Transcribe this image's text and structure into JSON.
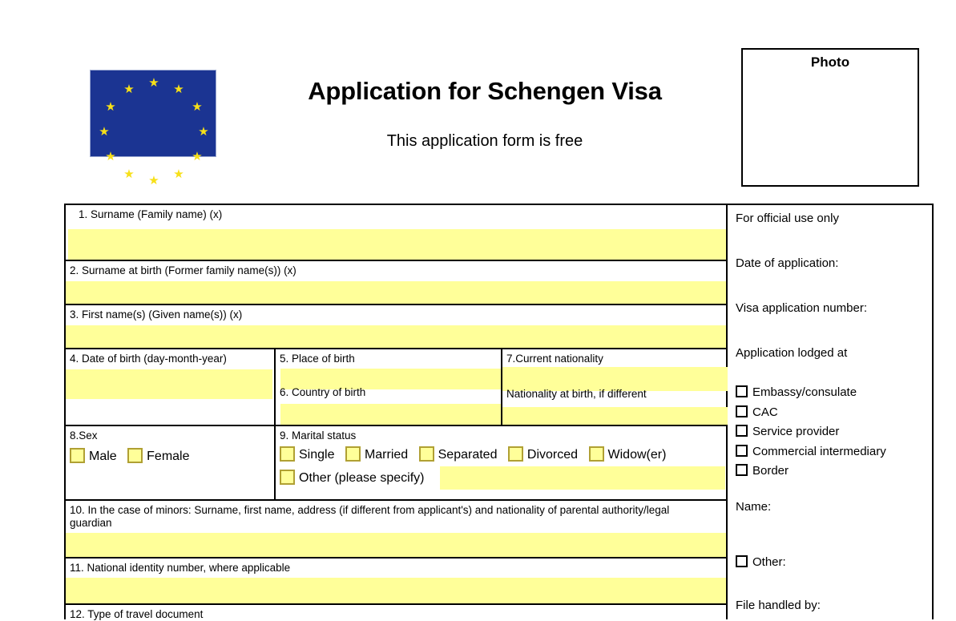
{
  "header": {
    "title": "Application for Schengen Visa",
    "subtitle": "This application form is free",
    "photo_label": "Photo",
    "flag_icon": "eu-flag-icon",
    "flag_color": "#1b3492",
    "star_color": "#f7e018"
  },
  "colors": {
    "field_yellow": "#ffff99",
    "checkbox_border_yellow": "#b0a033",
    "border_black": "#000000"
  },
  "form": {
    "field1": {
      "label": "1. Surname (Family name) (x)",
      "value": ""
    },
    "field2": {
      "label": "2. Surname at birth (Former family name(s)) (x)",
      "value": ""
    },
    "field3": {
      "label": "3. First name(s) (Given name(s)) (x)",
      "value": ""
    },
    "field4": {
      "label": "4. Date of birth (day-month-year)",
      "value": ""
    },
    "field5": {
      "label": "5. Place of birth",
      "value": ""
    },
    "field6": {
      "label": "6. Country of birth",
      "value": ""
    },
    "field7": {
      "label": "7.Current nationality",
      "value": "",
      "sublabel": "Nationality at birth, if different",
      "subvalue": ""
    },
    "field8": {
      "label": "8.Sex",
      "options": [
        {
          "label": "Male",
          "checked": false
        },
        {
          "label": "Female",
          "checked": false
        }
      ]
    },
    "field9": {
      "label": "9. Marital status",
      "options": [
        {
          "label": "Single",
          "checked": false
        },
        {
          "label": "Married",
          "checked": false
        },
        {
          "label": "Separated",
          "checked": false
        },
        {
          "label": "Divorced",
          "checked": false
        },
        {
          "label": "Widow(er)",
          "checked": false
        }
      ],
      "other_label": "Other (please specify)",
      "other_value": ""
    },
    "field10": {
      "label": "10. In the case of minors: Surname, first name, address (if different from applicant's) and nationality of parental authority/legal guardian",
      "value": ""
    },
    "field11": {
      "label": "11. National identity number, where applicable",
      "value": ""
    },
    "field12": {
      "label": "12. Type of travel document",
      "value": ""
    }
  },
  "official": {
    "heading": "For official use only",
    "date_of_application": "Date of application:",
    "visa_application_number": "Visa application number:",
    "lodged_at_heading": "Application lodged at",
    "lodged_at_options": [
      {
        "label": "Embassy/consulate",
        "checked": false
      },
      {
        "label": "CAC",
        "checked": false
      },
      {
        "label": "Service provider",
        "checked": false
      },
      {
        "label": "Commercial intermediary",
        "checked": false
      },
      {
        "label": "Border",
        "checked": false
      }
    ],
    "name_label": "Name:",
    "other_label": "Other:",
    "other_checked": false,
    "file_handled_by": "File handled by:"
  }
}
